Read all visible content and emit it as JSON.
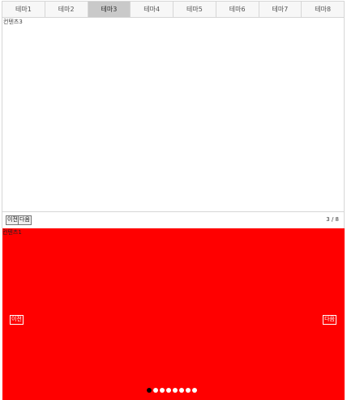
{
  "tabs": [
    {
      "label": "테마1"
    },
    {
      "label": "테마2"
    },
    {
      "label": "테마3",
      "active": true
    },
    {
      "label": "테마4"
    },
    {
      "label": "테마5"
    },
    {
      "label": "테마6"
    },
    {
      "label": "테마7"
    },
    {
      "label": "테마8"
    }
  ],
  "panel": {
    "content": "컨텐츠3"
  },
  "controls": {
    "prev_label": "이전",
    "next_label": "다음",
    "counter": "3 / 8"
  },
  "slider": {
    "label": "컨텐츠1",
    "prev_label": "이전",
    "next_label": "다음",
    "background": "#ff0000",
    "dot_count": 8,
    "active_dot": 1
  }
}
